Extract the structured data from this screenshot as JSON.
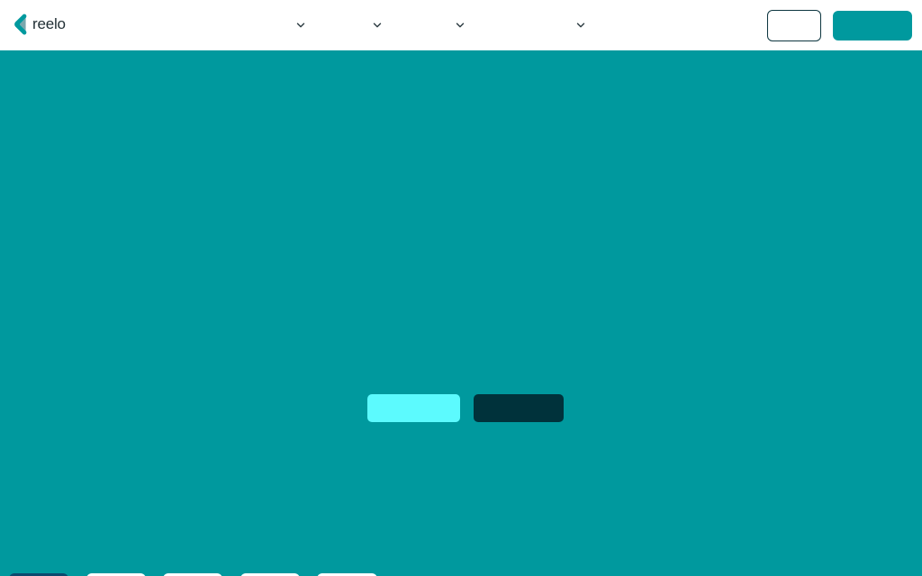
{
  "header": {
    "logo_text": "reelo",
    "brand_color": "#00999e",
    "nav_items": [
      {
        "label": "",
        "icon": "chevron-down-icon"
      },
      {
        "label": "",
        "icon": "chevron-down-icon"
      },
      {
        "label": "",
        "icon": "chevron-down-icon"
      },
      {
        "label": "",
        "icon": "chevron-down-icon"
      }
    ],
    "outline_button_label": "",
    "solid_button_label": ""
  },
  "hero": {
    "background_color": "#00999e",
    "primary_button_label": "",
    "primary_button_color": "#5cfafe",
    "secondary_button_label": "",
    "secondary_button_color": "#00323b"
  },
  "bottom_tabs": [
    {
      "label": ""
    },
    {
      "label": ""
    },
    {
      "label": ""
    },
    {
      "label": ""
    },
    {
      "label": ""
    }
  ]
}
